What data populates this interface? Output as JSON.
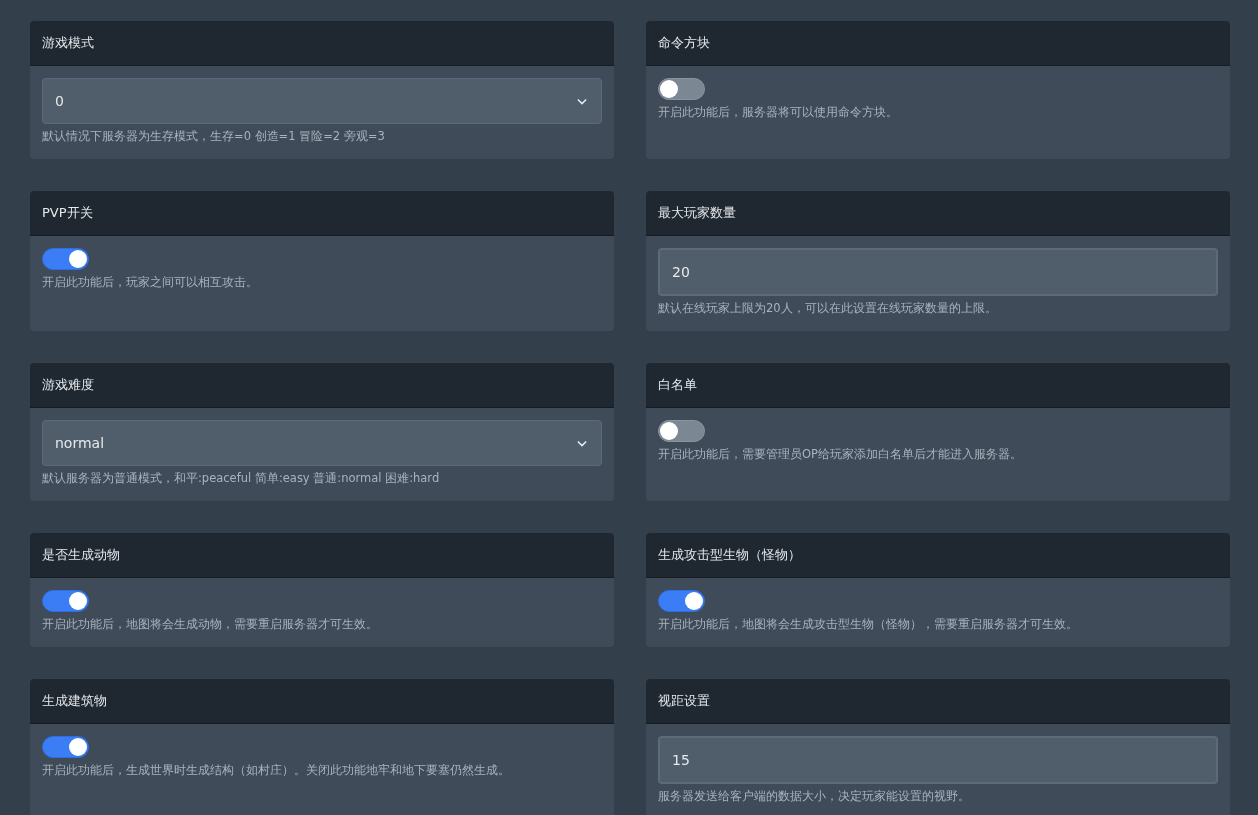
{
  "settings": [
    {
      "title": "游戏模式",
      "kind": "select",
      "value": "0",
      "hint": "默认情况下服务器为生存模式，生存=0 创造=1 冒险=2 旁观=3"
    },
    {
      "title": "命令方块",
      "kind": "toggle",
      "on": false,
      "hint": "开启此功能后，服务器将可以使用命令方块。"
    },
    {
      "title": "PVP开关",
      "kind": "toggle",
      "on": true,
      "hint": "开启此功能后，玩家之间可以相互攻击。"
    },
    {
      "title": "最大玩家数量",
      "kind": "input",
      "value": "20",
      "hint": "默认在线玩家上限为20人，可以在此设置在线玩家数量的上限。"
    },
    {
      "title": "游戏难度",
      "kind": "select",
      "value": "normal",
      "hint": "默认服务器为普通模式，和平:peaceful 简单:easy 普通:normal 困难:hard"
    },
    {
      "title": "白名单",
      "kind": "toggle",
      "on": false,
      "hint": "开启此功能后，需要管理员OP给玩家添加白名单后才能进入服务器。"
    },
    {
      "title": "是否生成动物",
      "kind": "toggle",
      "on": true,
      "hint": "开启此功能后，地图将会生成动物，需要重启服务器才可生效。"
    },
    {
      "title": "生成攻击型生物（怪物）",
      "kind": "toggle",
      "on": true,
      "hint": "开启此功能后，地图将会生成攻击型生物（怪物），需要重启服务器才可生效。"
    },
    {
      "title": "生成建筑物",
      "kind": "toggle",
      "on": true,
      "hint": "开启此功能后，生成世界时生成结构（如村庄）。关闭此功能地牢和地下要塞仍然生成。"
    },
    {
      "title": "视距设置",
      "kind": "input",
      "value": "15",
      "hint": "服务器发送给客户端的数据大小，决定玩家能设置的视野。"
    }
  ]
}
